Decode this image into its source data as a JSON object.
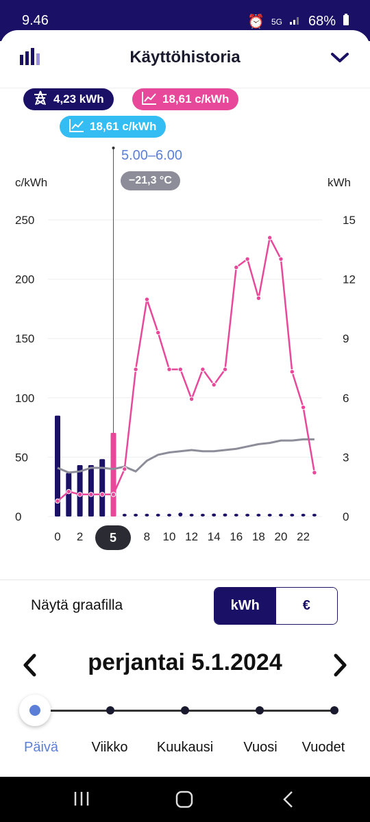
{
  "status_bar": {
    "time": "9.46",
    "battery": "68%",
    "network": "5G"
  },
  "header": {
    "title": "Käyttöhistoria",
    "left_icon": "bar-chart-icon",
    "right_icon": "chevron-down-icon"
  },
  "legend": {
    "energy": "4,23 kWh",
    "spot_price": "18,61 c/kWh",
    "fixed_price": "18,61 c/kWh"
  },
  "cursor": {
    "time_range": "5.00–6.00",
    "temperature": "−21,3 °C",
    "selected_hour_label": "5"
  },
  "chart_data": {
    "type": "bar",
    "left_axis_label": "c/kWh",
    "right_axis_label": "kWh",
    "left_ticks": [
      "250",
      "200",
      "150",
      "100",
      "50",
      "0"
    ],
    "right_ticks": [
      "15",
      "12",
      "9",
      "6",
      "3",
      "0"
    ],
    "x_tick_labels": [
      "0",
      "2",
      "5",
      "8",
      "10",
      "12",
      "14",
      "16",
      "18",
      "20",
      "22"
    ],
    "left_ylim": [
      0,
      250
    ],
    "right_ylim": [
      0,
      15
    ],
    "hours": [
      0,
      1,
      2,
      3,
      4,
      5,
      6,
      7,
      8,
      9,
      10,
      11,
      12,
      13,
      14,
      15,
      16,
      17,
      18,
      19,
      20,
      21,
      22,
      23
    ],
    "series": [
      {
        "name": "kWh",
        "axis": "right",
        "values": [
          5.1,
          2.2,
          2.6,
          2.6,
          2.9,
          4.23,
          0.05,
          0.05,
          0.05,
          0.05,
          0.05,
          0.2,
          0.1,
          0.1,
          0.15,
          0.15,
          0.1,
          0.1,
          0.1,
          0.1,
          0.1,
          0.1,
          0.1,
          0.1
        ]
      },
      {
        "name": "c/kWh",
        "axis": "left",
        "values": [
          13,
          21,
          18.6,
          18.6,
          18.6,
          18.6,
          40,
          124,
          183,
          155,
          124,
          124,
          99,
          124,
          111,
          124,
          210,
          217,
          184,
          235,
          217,
          122,
          92,
          37
        ]
      },
      {
        "name": "°C",
        "axis": "left",
        "values": [
          41,
          37,
          38,
          41,
          41,
          40,
          42,
          38,
          47,
          52,
          54,
          55,
          56,
          55,
          55,
          56,
          57,
          59,
          61,
          62,
          64,
          64,
          65,
          65
        ]
      }
    ],
    "selected_hour": 5,
    "colors": {
      "energy_bar": "#1a1166",
      "selected_bar": "#e8489a",
      "spot_line": "#e8489a",
      "temperature_line": "#8d8d99"
    }
  },
  "display": {
    "label": "Näytä graafilla",
    "options": [
      "kWh",
      "€"
    ],
    "selected": "kWh"
  },
  "date_nav": {
    "date": "perjantai 5.1.2024",
    "prev_icon": "chevron-left-icon",
    "next_icon": "chevron-right-icon"
  },
  "period": {
    "options": [
      "Päivä",
      "Viikko",
      "Kuukausi",
      "Vuosi",
      "Vuodet"
    ],
    "selected": "Päivä"
  },
  "nav_bar": {
    "icons": [
      "recent-apps-icon",
      "home-icon",
      "back-icon"
    ]
  }
}
